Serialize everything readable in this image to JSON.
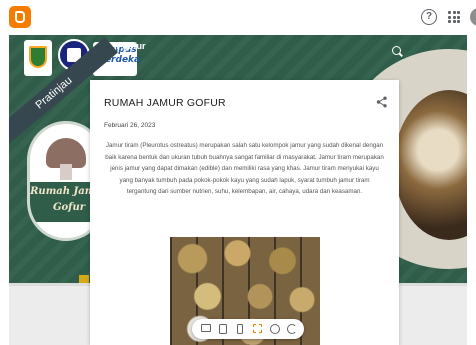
{
  "app": {
    "logo_icon": "blogger-logo-icon",
    "help_icon": "help-icon",
    "apps_icon": "apps-grid-icon",
    "help_glyph": "?"
  },
  "preview": {
    "ribbon": "Pratinjau",
    "blog_title": "Jamur gofur",
    "merdeka_line1": "Kampus",
    "merdeka_line2": "Merdeka",
    "merdeka_sub": "INDONESIA JAYA",
    "badge_line1": "Rumah Jamur",
    "badge_line2": "Gofur",
    "search_icon": "search-icon"
  },
  "post": {
    "title": "RUMAH JAMUR GOFUR",
    "date": "Februari 26, 2023",
    "body": "Jamur tiram (Pleurotus ostreatus) merupakan salah satu kelompok jamur yang sudah dikenal dengan baik karena bentuk dan ukuran tubuh buahnya sangat familiar di masyarakat. Jamur tiram merupakan jenis jamur yang dapat dimakan (edible) dan memiliki rasa yang khas. Jamur tiram menyukai kayu yang banyak tumbuh pada pokok-pokok kayu yang sudah lapuk, syarat tumbuh jamur tiram tergantung dari sumber nutrien, suhu, kelembapan, air, cahaya, udara dan keasaman.",
    "share_icon": "share-icon"
  },
  "toolbar": {
    "items": [
      "desktop-view-icon",
      "tablet-view-icon",
      "phone-view-icon",
      "fit-view-icon",
      "globe-icon",
      "refresh-icon"
    ],
    "active": "fit-view-icon"
  },
  "colors": {
    "blogger_orange": "#f57c00",
    "hero_green": "#2f5d4a"
  }
}
